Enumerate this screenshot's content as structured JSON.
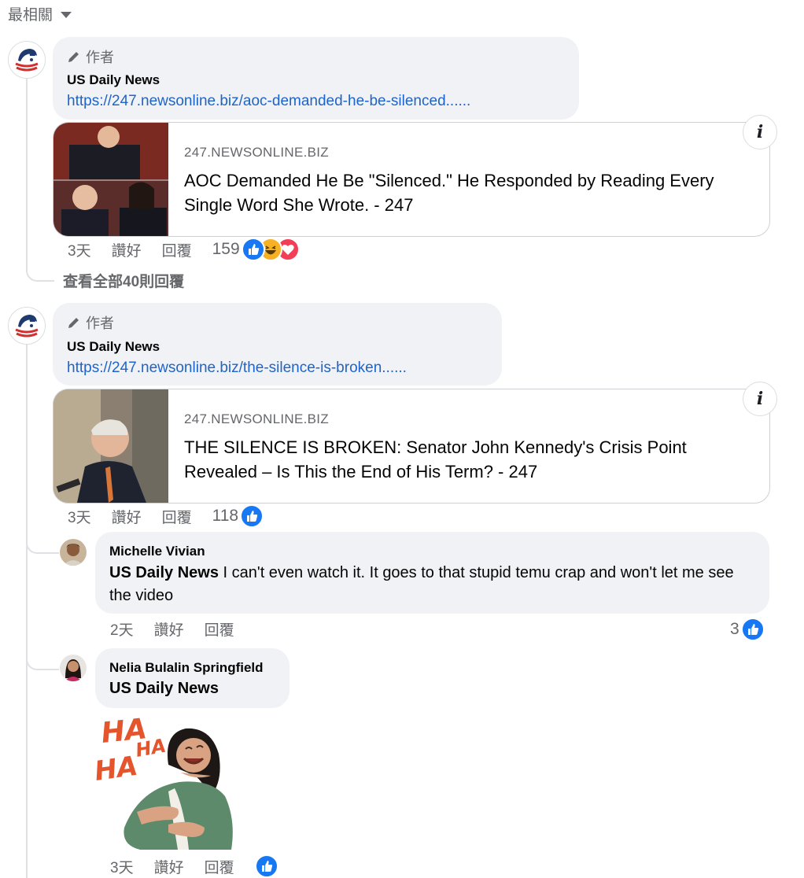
{
  "sort": {
    "label": "最相關"
  },
  "comments": [
    {
      "author_badge": "作者",
      "name": "US Daily News",
      "link": "https://247.newsonline.biz/aoc-demanded-he-be-silenced......",
      "card": {
        "domain": "247.NEWSONLINE.BIZ",
        "title": "AOC Demanded He Be \"Silenced.\" He Responded by Reading Every Single Word She Wrote. - 247"
      },
      "time": "3天",
      "like_label": "讚好",
      "reply_label": "回覆",
      "reaction_count": "159",
      "reactions": [
        "like",
        "haha",
        "love"
      ]
    },
    {
      "author_badge": "作者",
      "name": "US Daily News",
      "link": "https://247.newsonline.biz/the-silence-is-broken......",
      "card": {
        "domain": "247.NEWSONLINE.BIZ",
        "title": "THE SILENCE IS BROKEN: Senator John Kennedy's Crisis Point Revealed – Is This the End of His Term? - 247"
      },
      "time": "3天",
      "like_label": "讚好",
      "reply_label": "回覆",
      "reaction_count": "118",
      "reactions": [
        "like"
      ]
    }
  ],
  "view_all_replies": "查看全部40則回覆",
  "replies": [
    {
      "name": "Michelle Vivian",
      "mention": "US Daily News",
      "text": " I can't even watch it. It goes to that stupid temu crap and won't let me see the video",
      "time": "2天",
      "like_label": "讚好",
      "reply_label": "回覆",
      "reaction_count": "3"
    },
    {
      "name": "Nelia Bulalin Springfield",
      "mention": "US Daily News",
      "sticker_text": "HA HA HA",
      "time": "3天",
      "like_label": "讚好",
      "reply_label": "回覆"
    }
  ],
  "colors": {
    "link": "#1f64c8",
    "like": "#1877f2",
    "bubble": "#f0f2f5",
    "muted": "#65676b"
  }
}
